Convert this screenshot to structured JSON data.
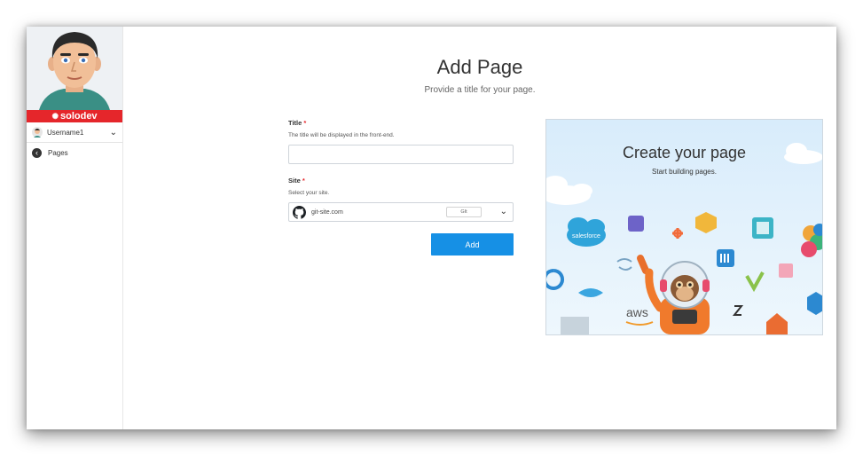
{
  "brand": {
    "name": "solodev",
    "color": "#e5262b"
  },
  "sidebar": {
    "username": "Username1",
    "items": [
      {
        "label": "Pages",
        "icon": "arrow-left-circle-icon"
      }
    ]
  },
  "main": {
    "title": "Add Page",
    "subtitle": "Provide a title for your page."
  },
  "form": {
    "title_field": {
      "label": "Title",
      "required_mark": "*",
      "hint": "The title will be displayed in the front-end.",
      "value": "",
      "placeholder": ""
    },
    "site_field": {
      "label": "Site",
      "required_mark": "*",
      "hint": "Select your site.",
      "selected": "git-site.com",
      "tag": "GIt",
      "icon": "github-icon"
    },
    "submit_label": "Add",
    "accent_color": "#1690e5"
  },
  "promo": {
    "title": "Create your page",
    "subtitle": "Start building pages.",
    "logos": [
      "salesforce",
      "aws"
    ]
  }
}
